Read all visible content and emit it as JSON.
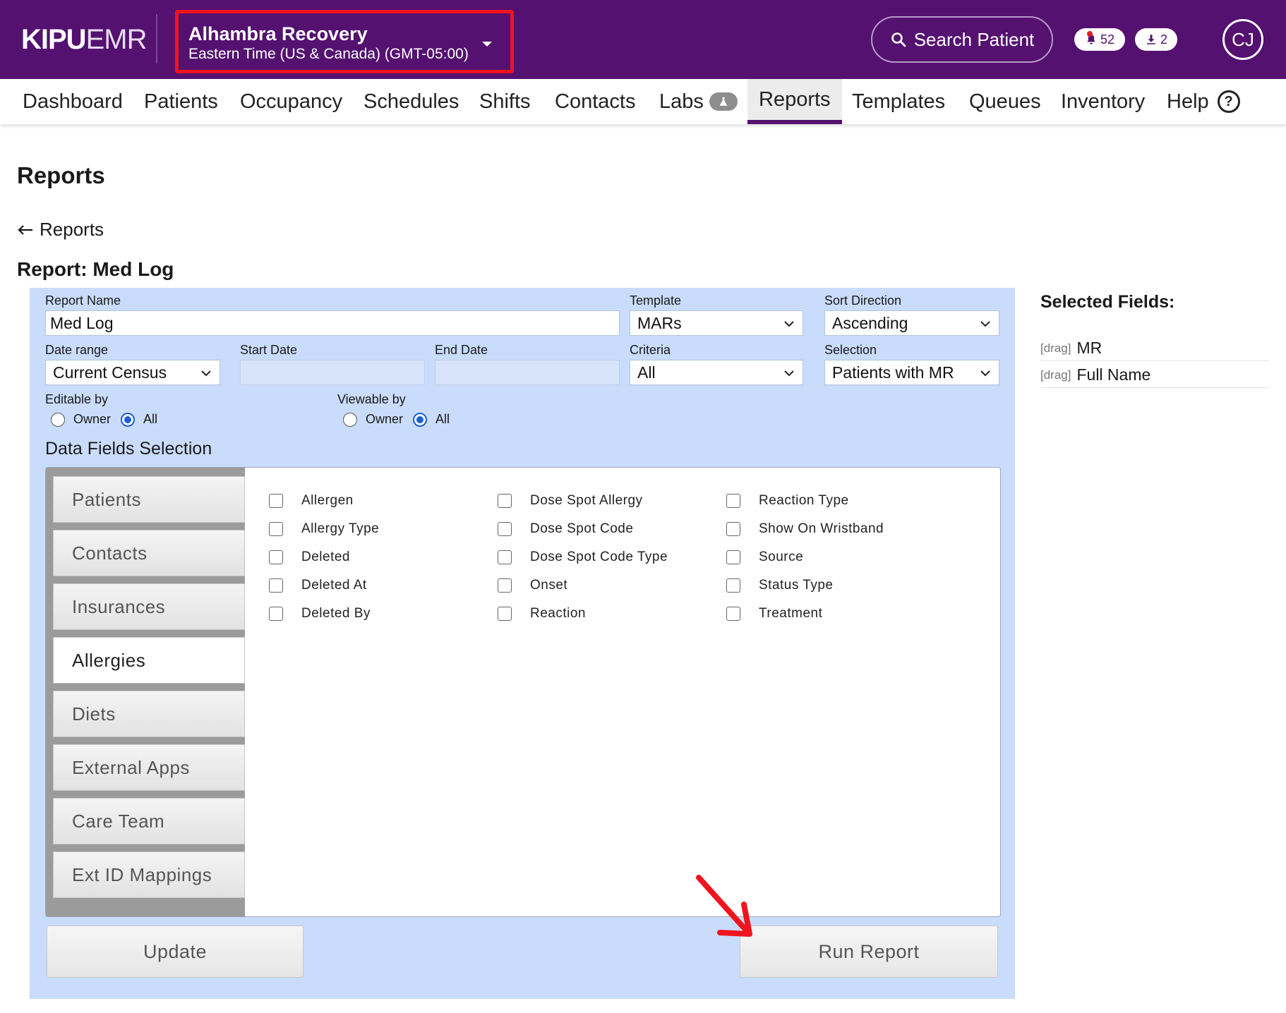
{
  "header": {
    "logo_bold": "KIPU",
    "logo_light": "EMR",
    "facility_name": "Alhambra Recovery",
    "facility_timezone": "Eastern Time (US & Canada) (GMT-05:00)",
    "search_label": "Search Patient",
    "alerts_count": "52",
    "downloads_count": "2",
    "avatar_initials": "CJ",
    "accent_color": "#541170",
    "highlight_color": "#f0141e"
  },
  "nav": {
    "items": [
      "Dashboard",
      "Patients",
      "Occupancy",
      "Schedules",
      "Shifts",
      "Contacts",
      "Labs",
      "Reports",
      "Templates",
      "Queues",
      "Inventory",
      "Help"
    ],
    "active": "Reports"
  },
  "page": {
    "title": "Reports",
    "back_label": "Reports",
    "report_title": "Report: Med Log"
  },
  "form": {
    "report_name_label": "Report Name",
    "report_name_value": "Med Log",
    "template_label": "Template",
    "template_value": "MARs",
    "sort_direction_label": "Sort Direction",
    "sort_direction_value": "Ascending",
    "date_range_label": "Date range",
    "date_range_value": "Current Census",
    "start_date_label": "Start Date",
    "end_date_label": "End Date",
    "criteria_label": "Criteria",
    "criteria_value": "All",
    "selection_label": "Selection",
    "selection_value": "Patients with MR",
    "editable_by_label": "Editable by",
    "viewable_by_label": "Viewable by",
    "owner_label": "Owner",
    "all_label": "All",
    "editable_by_selected": "All",
    "viewable_by_selected": "All",
    "data_fields_title": "Data Fields Selection",
    "tabs": [
      "Patients",
      "Contacts",
      "Insurances",
      "Allergies",
      "Diets",
      "External Apps",
      "Care Team",
      "Ext ID Mappings"
    ],
    "active_tab": "Allergies",
    "checkbox_columns": [
      [
        "Allergen",
        "Allergy Type",
        "Deleted",
        "Deleted At",
        "Deleted By"
      ],
      [
        "Dose Spot Allergy",
        "Dose Spot Code",
        "Dose Spot Code Type",
        "Onset",
        "Reaction"
      ],
      [
        "Reaction Type",
        "Show On Wristband",
        "Source",
        "Status Type",
        "Treatment"
      ]
    ],
    "update_label": "Update",
    "run_report_label": "Run Report"
  },
  "selected_fields": {
    "title": "Selected Fields:",
    "drag_label": "[drag]",
    "items": [
      "MR",
      "Full Name"
    ]
  }
}
